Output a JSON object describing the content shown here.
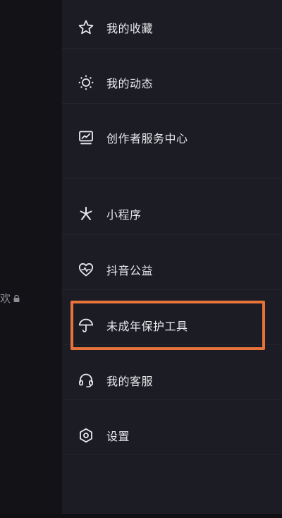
{
  "background": {
    "partial_text": "欢",
    "lock_icon": "lock-icon"
  },
  "menu": {
    "items": [
      {
        "label": "我的收藏",
        "icon": "star-icon"
      },
      {
        "label": "我的动态",
        "icon": "sun-dotted-icon"
      },
      {
        "label": "创作者服务中心",
        "icon": "chart-monitor-icon"
      },
      {
        "label": "小程序",
        "icon": "asterisk-icon"
      },
      {
        "label": "抖音公益",
        "icon": "heart-wave-icon"
      },
      {
        "label": "未成年保护工具",
        "icon": "umbrella-icon"
      },
      {
        "label": "我的客服",
        "icon": "headset-icon"
      },
      {
        "label": "设置",
        "icon": "hexagon-gear-icon"
      }
    ]
  },
  "colors": {
    "drawer_bg": "#1c1c24",
    "page_bg": "#16161c",
    "text": "#e8e8ec",
    "highlight": "#e8733a"
  }
}
